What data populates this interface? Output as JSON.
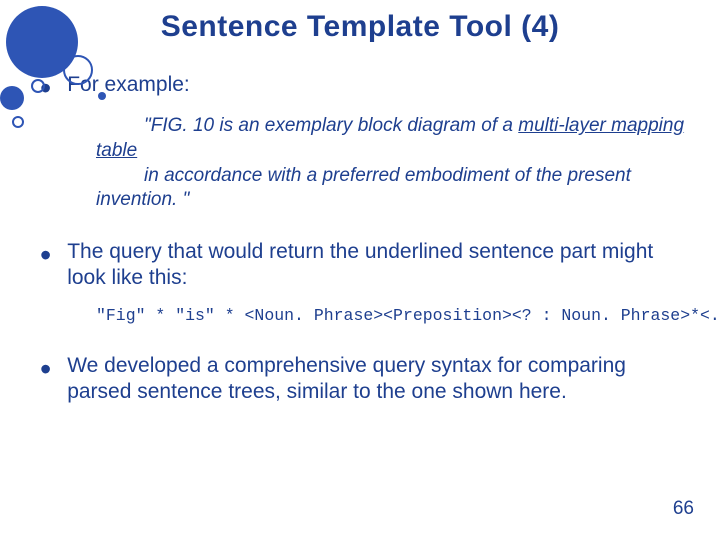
{
  "title": "Sentence Template Tool (4)",
  "bullets": {
    "b1": "For example:",
    "b2": "The query that would return the underlined sentence part might look like this:",
    "b3": "We developed a comprehensive query syntax for comparing parsed sentence trees, similar to the one shown here."
  },
  "example": {
    "line1_pre": "\"FIG. 10 is an exemplary block diagram of a ",
    "line1_u": "multi-layer mapping",
    "line2_u": "table",
    "line3": "in accordance with a preferred embodiment of the present invention. \""
  },
  "query": "\"Fig\" * \"is\" * <Noun. Phrase><Preposition><? : Noun. Phrase>*<. >",
  "page_number": "66"
}
